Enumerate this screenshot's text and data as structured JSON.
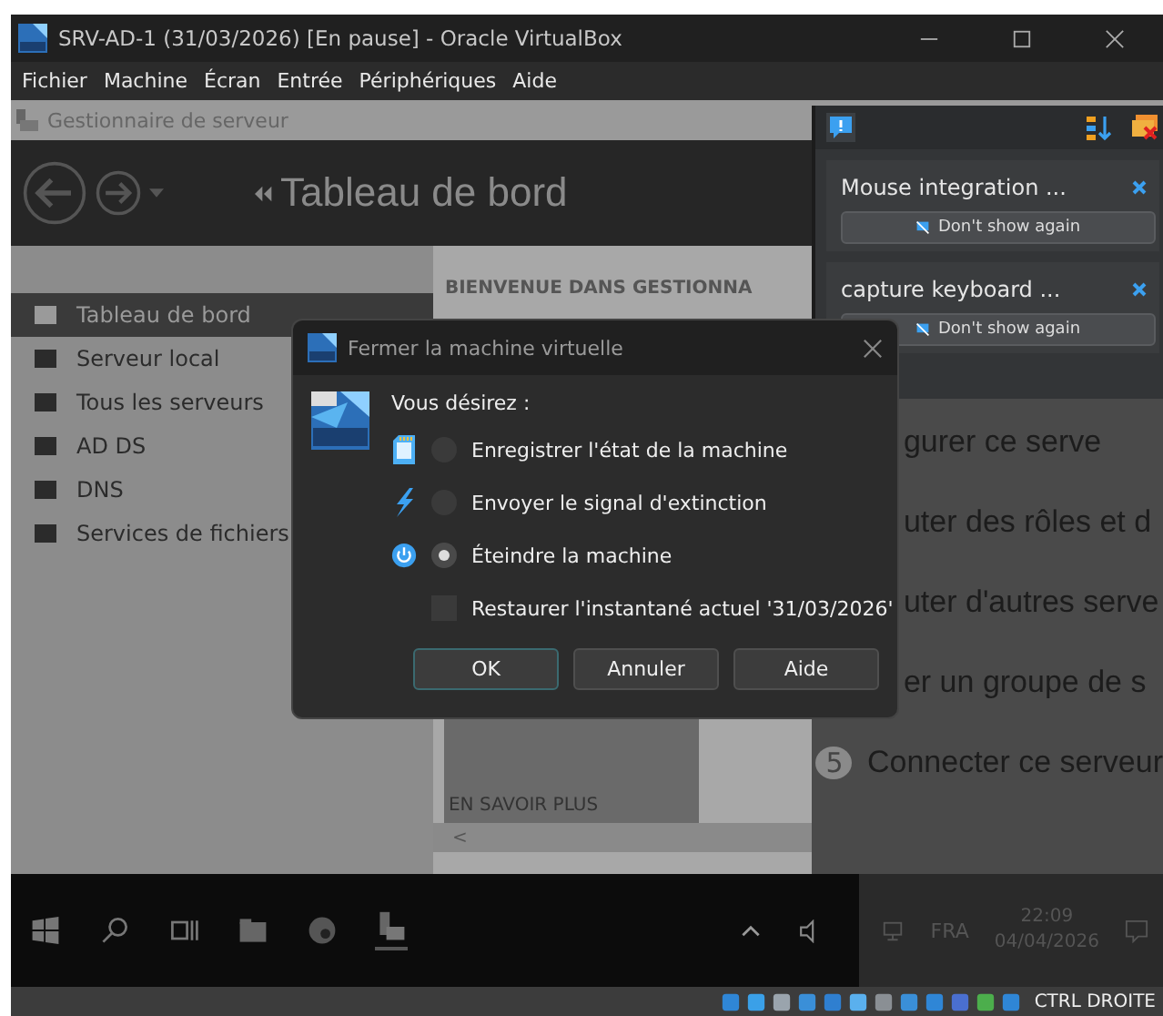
{
  "window": {
    "title": "SRV-AD-1 (31/03/2026) [En pause] - Oracle VirtualBox"
  },
  "menu": [
    "Fichier",
    "Machine",
    "Écran",
    "Entrée",
    "Périphériques",
    "Aide"
  ],
  "guest": {
    "app_title": "Gestionnaire de serveur",
    "header_title": "Tableau de bord",
    "sidebar": [
      {
        "label": "Tableau de bord",
        "selected": true
      },
      {
        "label": "Serveur local",
        "selected": false
      },
      {
        "label": "Tous les serveurs",
        "selected": false
      },
      {
        "label": "AD DS",
        "selected": false
      },
      {
        "label": "DNS",
        "selected": false
      },
      {
        "label": "Services de fichiers",
        "selected": false
      }
    ],
    "welcome": "BIENVENUE DANS GESTIONNA",
    "steps": [
      {
        "text": "gurer ce serve"
      },
      {
        "text": "uter des rôles et d"
      },
      {
        "text": "uter d'autres serve"
      },
      {
        "text": "er un groupe de s"
      },
      {
        "number": "5",
        "text": "Connecter ce serveur"
      }
    ],
    "learn_more": "EN SAVOIR PLUS",
    "scroll_left": "<",
    "tray": {
      "language": "FRA",
      "time": "22:09",
      "date": "04/04/2026"
    }
  },
  "notifications": [
    {
      "text": "Mouse integration ...",
      "button": "Don't show again"
    },
    {
      "text": "capture keyboard ...",
      "button": "Don't show again"
    }
  ],
  "dialog": {
    "title": "Fermer la machine virtuelle",
    "prompt": "Vous désirez :",
    "options": [
      {
        "kind": "save",
        "label": "Enregistrer l'état de la machine",
        "selected": false
      },
      {
        "kind": "signal",
        "label": "Envoyer le signal d'extinction",
        "selected": false
      },
      {
        "kind": "power",
        "label": "Éteindre la machine",
        "selected": true
      }
    ],
    "restore": {
      "label": "Restaurer l'instantané actuel '31/03/2026'",
      "checked": false
    },
    "buttons": [
      {
        "label": "OK",
        "default": true
      },
      {
        "label": "Annuler",
        "default": false
      },
      {
        "label": "Aide",
        "default": false
      }
    ]
  },
  "status_bar": {
    "host_key": "CTRL DROITE"
  }
}
